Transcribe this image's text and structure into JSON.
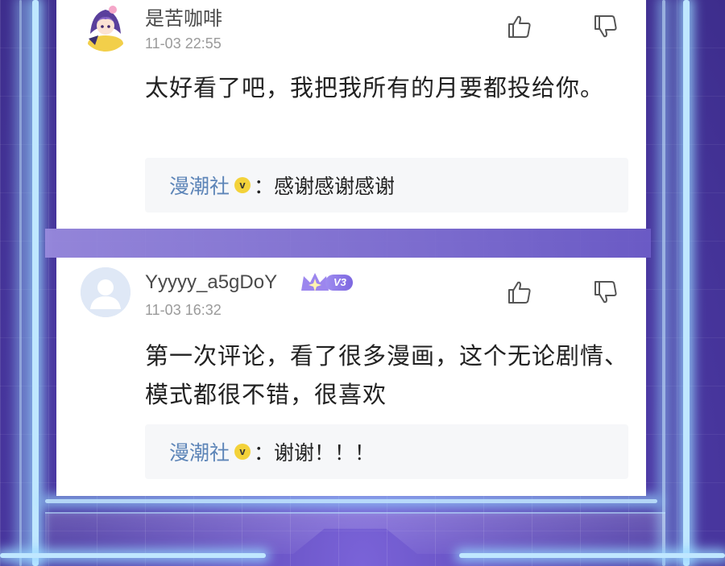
{
  "comments": [
    {
      "username": "是苦咖啡",
      "timestamp": "11-03 22:55",
      "content": "太好看了吧，我把我所有的月要都投给你。",
      "reply": {
        "author": "漫潮社",
        "badge": "v",
        "separator": "：",
        "text": "感谢感谢感谢"
      }
    },
    {
      "username": "Yyyyy_a5gDoY",
      "vip_level": "V3",
      "timestamp": "11-03 16:32",
      "content": "第一次评论，看了很多漫画，这个无论剧情、模式都很不错，很喜欢",
      "reply": {
        "author": "漫潮社",
        "badge": "v",
        "separator": "：",
        "text": "谢谢！！！"
      }
    }
  ],
  "icons": {
    "like": "thumbs-up-icon",
    "dislike": "thumbs-down-icon",
    "vip": "crown-icon"
  },
  "colors": {
    "reply_author": "#5d85b8",
    "verified_badge": "#f3d23a",
    "background": "#5b46b8",
    "vip_badge": "#8a76e6"
  }
}
